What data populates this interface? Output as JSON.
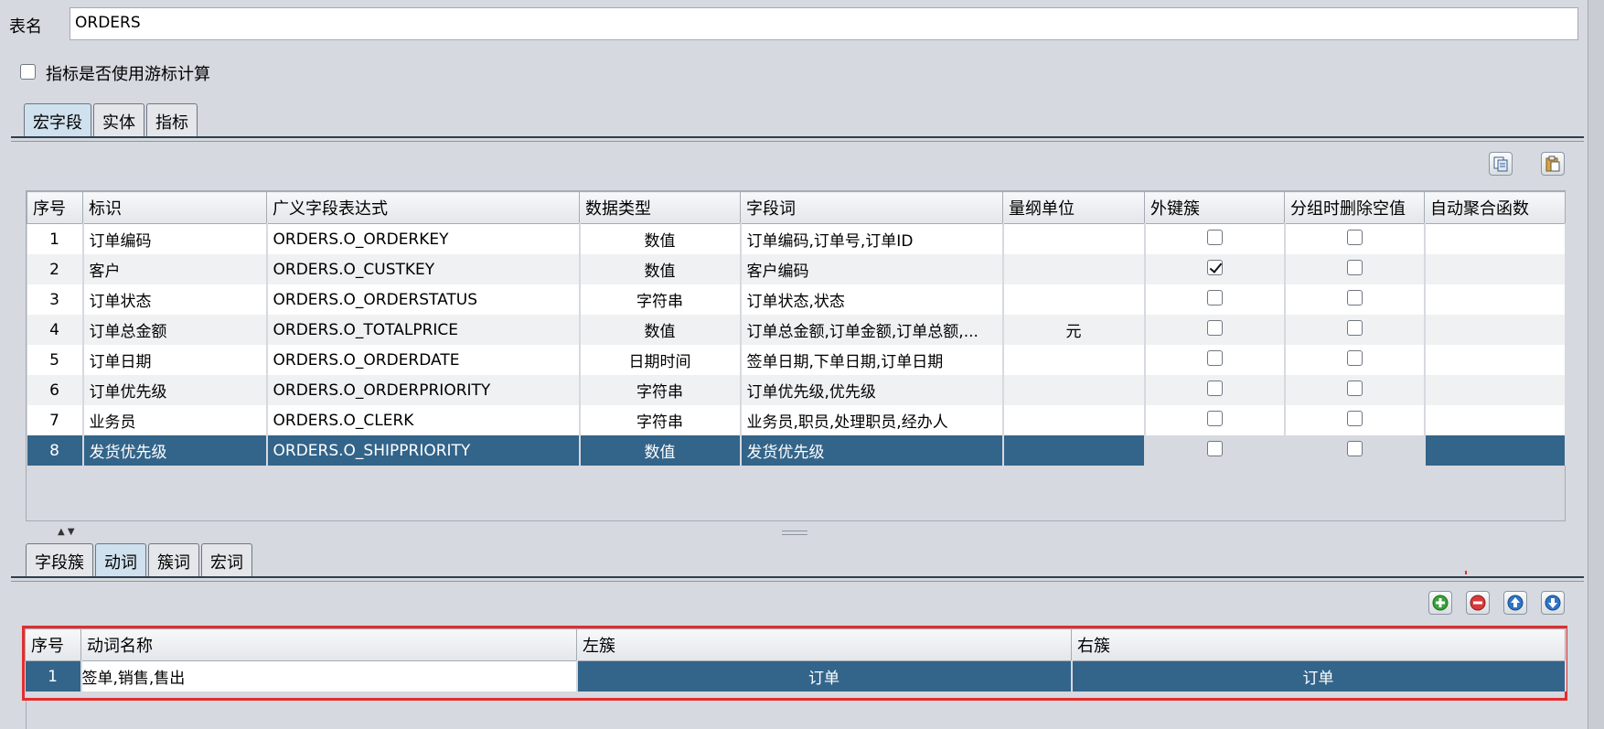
{
  "table_name": {
    "label": "表名",
    "value": "ORDERS"
  },
  "cursor_option": {
    "label": "指标是否使用游标计算",
    "checked": false
  },
  "top_tabs": [
    {
      "label": "宏字段",
      "active": true
    },
    {
      "label": "实体",
      "active": false
    },
    {
      "label": "指标",
      "active": false
    }
  ],
  "top_toolbar": {
    "copy_icon": "copy-icon",
    "paste_icon": "paste-icon"
  },
  "fields_table": {
    "headers": [
      "序号",
      "标识",
      "广义字段表达式",
      "数据类型",
      "字段词",
      "量纲单位",
      "外键簇",
      "分组时删除空值",
      "自动聚合函数"
    ],
    "rows": [
      {
        "no": "1",
        "id": "订单编码",
        "expr": "ORDERS.O_ORDERKEY",
        "type": "数值",
        "words": "订单编码,订单号,订单ID",
        "unit": "",
        "fk": false,
        "dropnull": false,
        "agg": ""
      },
      {
        "no": "2",
        "id": "客户",
        "expr": "ORDERS.O_CUSTKEY",
        "type": "数值",
        "words": "客户编码",
        "unit": "",
        "fk": true,
        "dropnull": false,
        "agg": ""
      },
      {
        "no": "3",
        "id": "订单状态",
        "expr": "ORDERS.O_ORDERSTATUS",
        "type": "字符串",
        "words": "订单状态,状态",
        "unit": "",
        "fk": false,
        "dropnull": false,
        "agg": ""
      },
      {
        "no": "4",
        "id": "订单总金额",
        "expr": "ORDERS.O_TOTALPRICE",
        "type": "数值",
        "words": "订单总金额,订单金额,订单总额,...",
        "unit": "元",
        "fk": false,
        "dropnull": false,
        "agg": ""
      },
      {
        "no": "5",
        "id": "订单日期",
        "expr": "ORDERS.O_ORDERDATE",
        "type": "日期时间",
        "words": "签单日期,下单日期,订单日期",
        "unit": "",
        "fk": false,
        "dropnull": false,
        "agg": ""
      },
      {
        "no": "6",
        "id": "订单优先级",
        "expr": "ORDERS.O_ORDERPRIORITY",
        "type": "字符串",
        "words": "订单优先级,优先级",
        "unit": "",
        "fk": false,
        "dropnull": false,
        "agg": ""
      },
      {
        "no": "7",
        "id": "业务员",
        "expr": "ORDERS.O_CLERK",
        "type": "字符串",
        "words": "业务员,职员,处理职员,经办人",
        "unit": "",
        "fk": false,
        "dropnull": false,
        "agg": ""
      },
      {
        "no": "8",
        "id": "发货优先级",
        "expr": "ORDERS.O_SHIPPRIORITY",
        "type": "数值",
        "words": "发货优先级",
        "unit": "",
        "fk": false,
        "dropnull": false,
        "agg": "",
        "selected": true
      }
    ]
  },
  "bottom_tabs": [
    {
      "label": "字段簇",
      "active": false
    },
    {
      "label": "动词",
      "active": true
    },
    {
      "label": "簇词",
      "active": false
    },
    {
      "label": "宏词",
      "active": false
    }
  ],
  "bottom_toolbar": {
    "add_icon": "add-icon",
    "remove_icon": "remove-icon",
    "up_icon": "arrow-up-icon",
    "down_icon": "arrow-down-icon"
  },
  "verbs_table": {
    "headers": [
      "序号",
      "动词名称",
      "左簇",
      "右簇"
    ],
    "rows": [
      {
        "no": "1",
        "name": "签单,销售,售出",
        "left": "订单",
        "right": "订单"
      }
    ]
  },
  "colors": {
    "selection": "#33648a",
    "highlight_border": "#e32d2d",
    "panel_bg": "#d6d9df"
  }
}
